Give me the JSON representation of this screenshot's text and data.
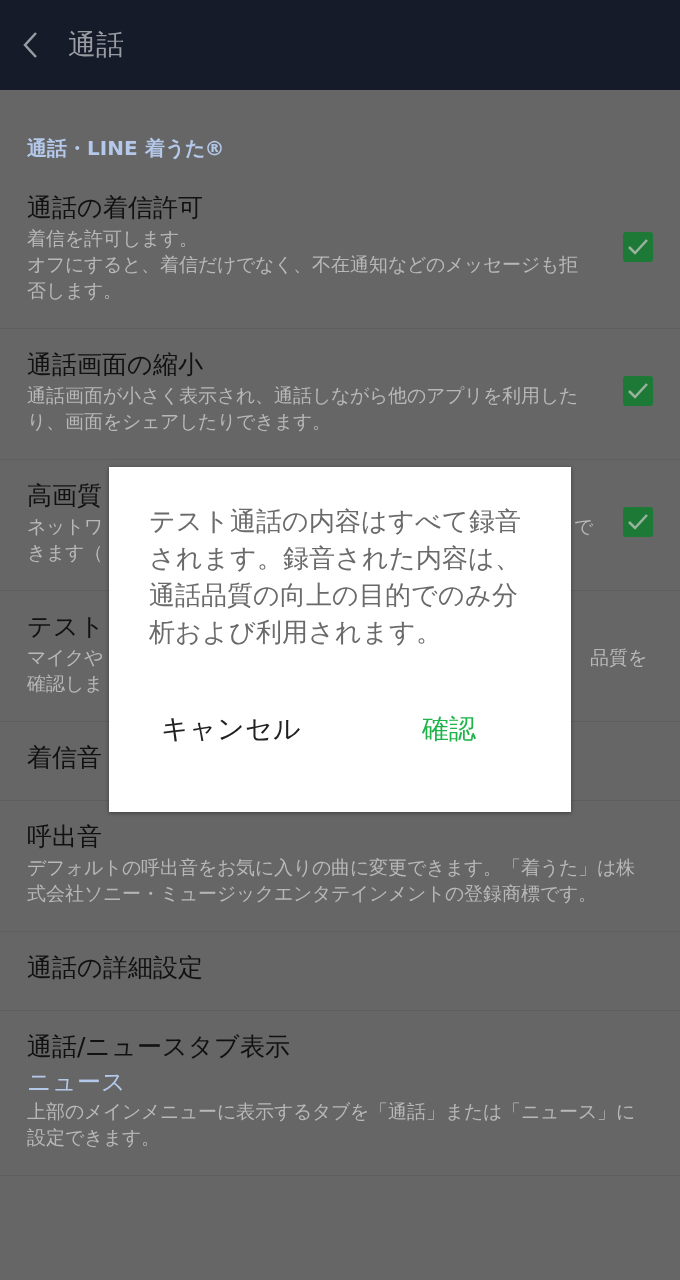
{
  "header": {
    "title": "通話"
  },
  "section": {
    "title": "通話・LINE 着うた®"
  },
  "items": [
    {
      "kind": "checkbox",
      "title": "通話の着信許可",
      "description": [
        "着信を許可します。",
        "オフにすると、着信だけでなく、不在通知などのメッセージも拒否します。"
      ],
      "checked": true
    },
    {
      "kind": "checkbox",
      "title": "通話画面の縮小",
      "description": [
        "通話画面が小さく表示され、通話しながら他のアプリを利用したり、画面をシェアしたりできます。"
      ],
      "checked": true
    },
    {
      "kind": "checkbox",
      "title": "高画質",
      "description_fragments": [
        {
          "left": "ネットワ",
          "right": "で"
        },
        {
          "left": "きます（"
        }
      ],
      "checked": true
    },
    {
      "kind": "plain",
      "title": "テスト",
      "description_fragments": [
        {
          "left": "マイクや",
          "right": "品質を"
        },
        {
          "left": "確認しま"
        }
      ]
    },
    {
      "kind": "plain",
      "title": "着信音"
    },
    {
      "kind": "plain",
      "title": "呼出音",
      "description": [
        "デフォルトの呼出音をお気に入りの曲に変更できます。「着うた」は株式会社ソニー・ミュージックエンタテインメントの登録商標です。"
      ]
    },
    {
      "kind": "plain",
      "title": "通話の詳細設定"
    },
    {
      "kind": "value",
      "title": "通話/ニュースタブ表示",
      "value": "ニュース",
      "description": [
        "上部のメインメニューに表示するタブを「通話」または「ニュース」に設定できます。"
      ]
    }
  ],
  "dialog": {
    "message": "テスト通話の内容はすべて録音されます。録音された内容は、通話品質の向上の目的でのみ分析および利用されます。",
    "buttons": [
      {
        "label": "キャンセル",
        "kind": "neutral"
      },
      {
        "label": "確認",
        "kind": "primary"
      }
    ]
  }
}
